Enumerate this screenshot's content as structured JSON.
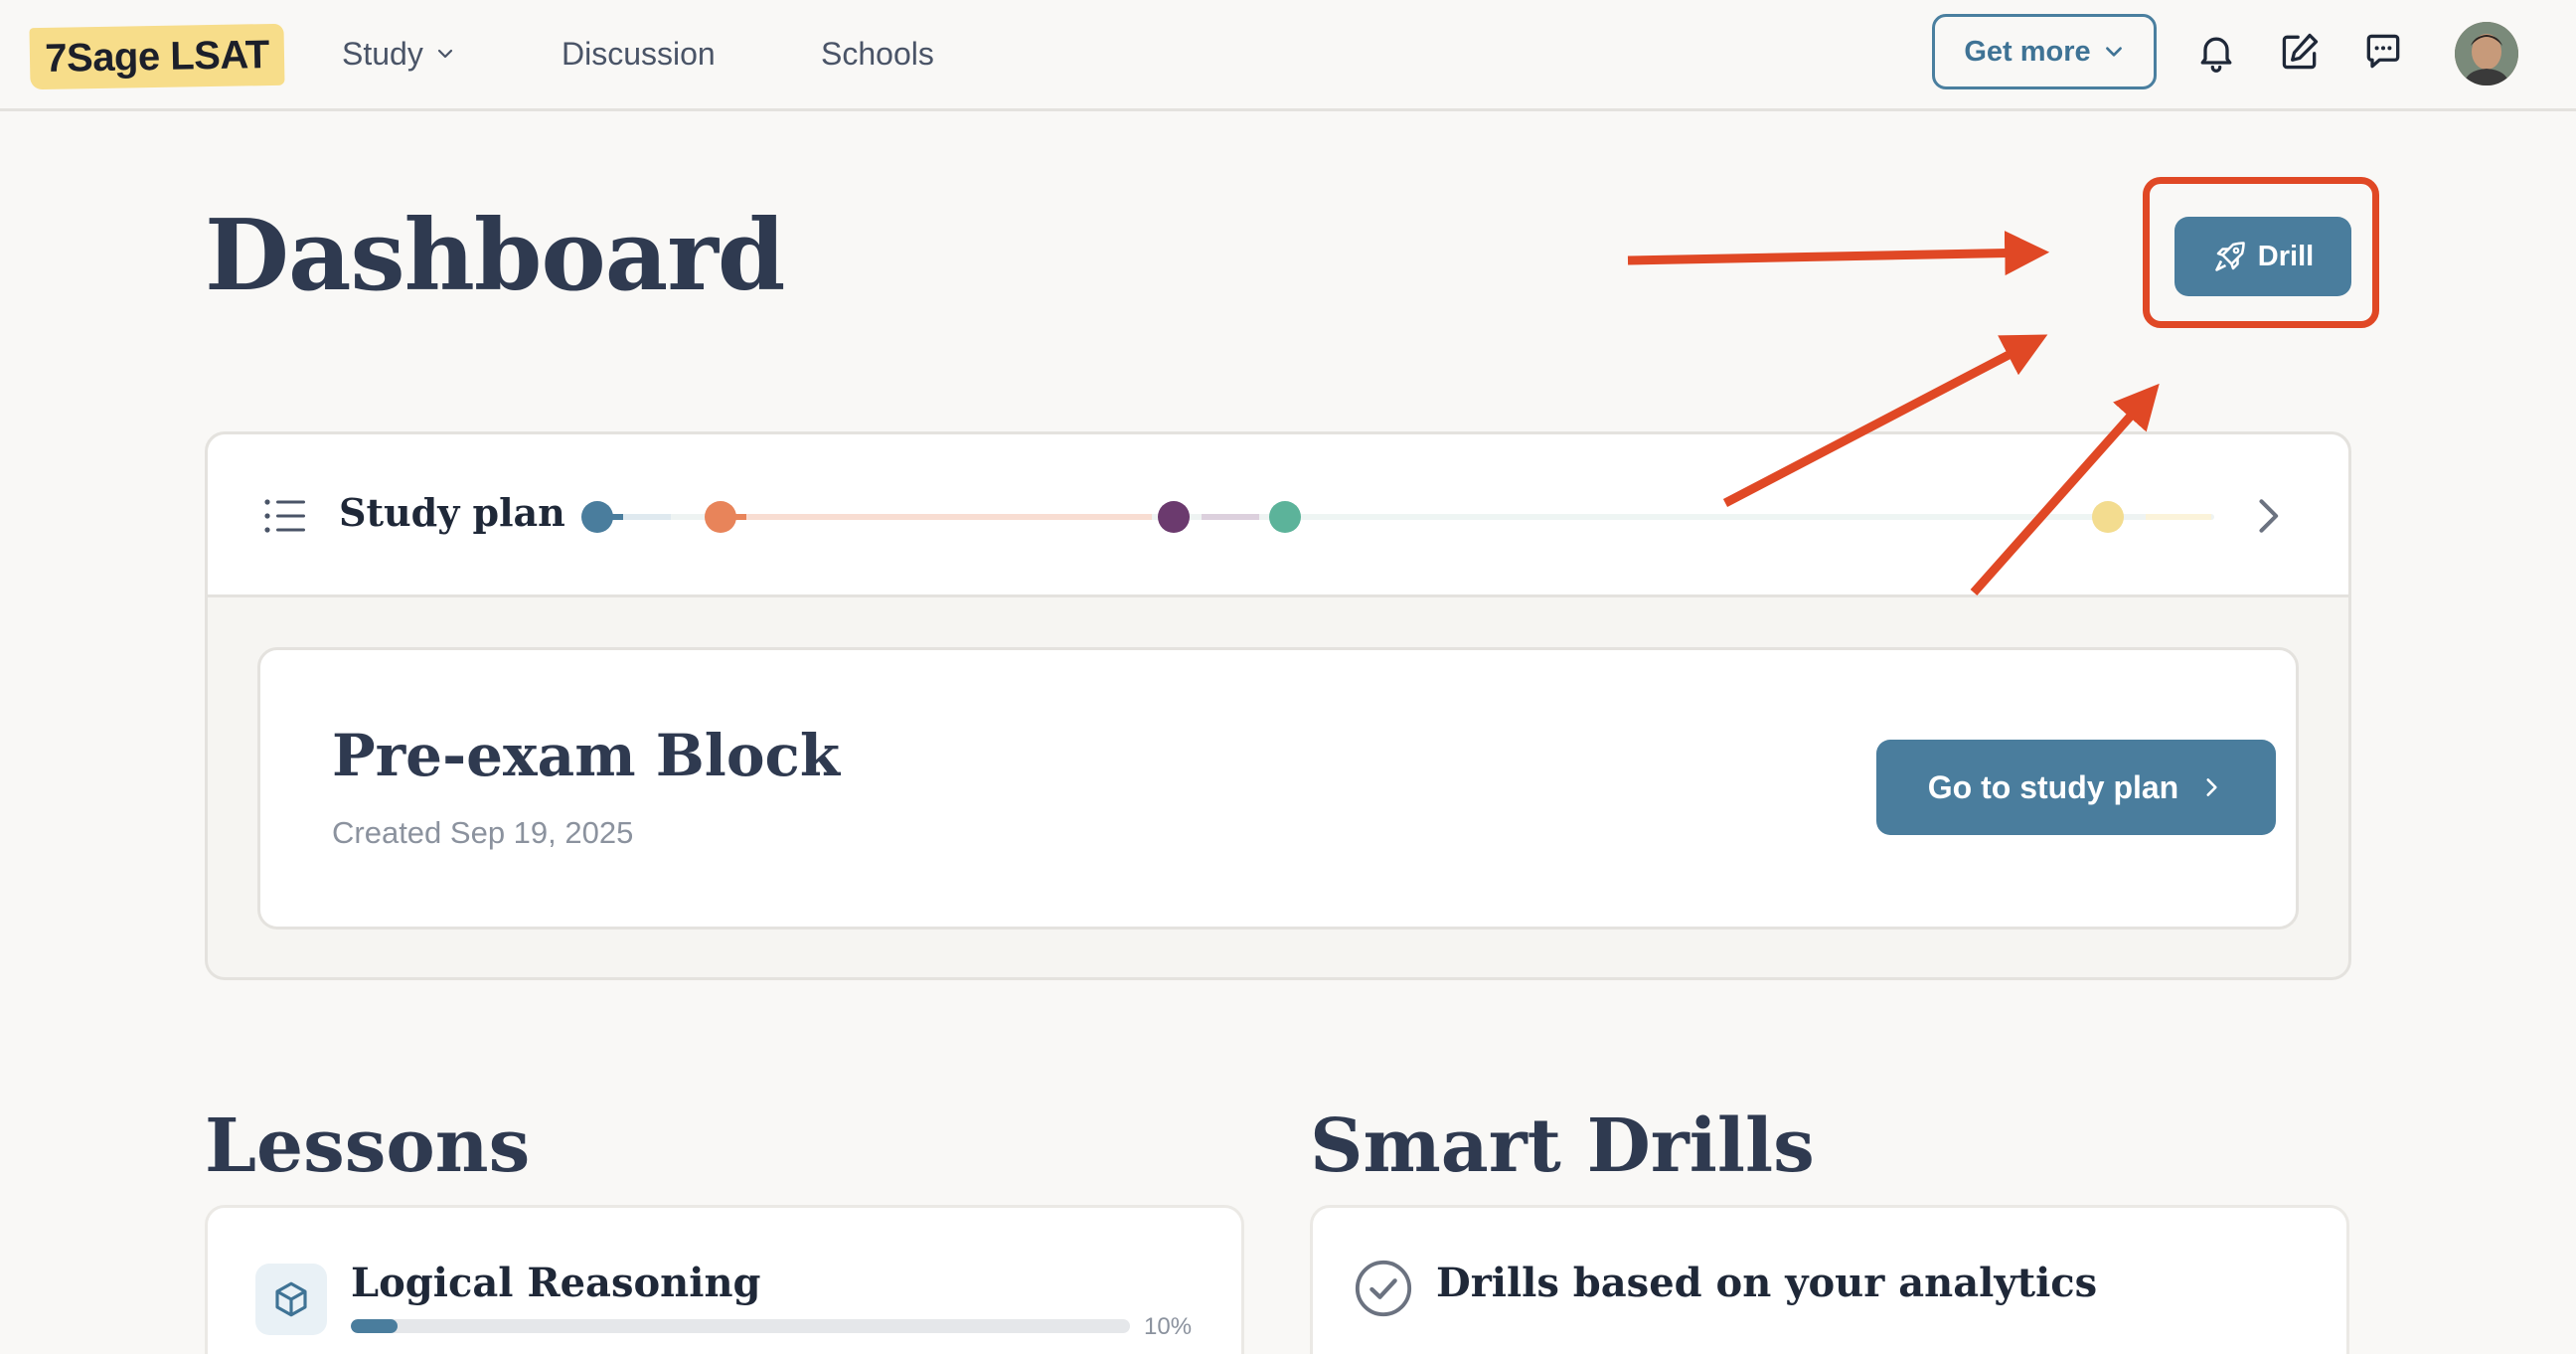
{
  "nav": {
    "logo": "7Sage LSAT",
    "links": [
      {
        "label": "Study",
        "has_dropdown": true
      },
      {
        "label": "Discussion"
      },
      {
        "label": "Schools"
      }
    ],
    "get_more": "Get more",
    "icons": [
      "bell-icon",
      "edit-icon",
      "chat-icon",
      "avatar"
    ]
  },
  "header": {
    "title": "Dashboard",
    "drill_button": "Drill"
  },
  "study_plan": {
    "title": "Study plan",
    "timeline_colors": [
      "#4a7d9d",
      "#e8845a",
      "#6b3a6e",
      "#5cb39a",
      "#f3dc8f"
    ],
    "block": {
      "title": "Pre-exam Block",
      "created": "Created Sep 19, 2025",
      "button": "Go to study plan"
    }
  },
  "lessons": {
    "title": "Lessons",
    "items": [
      {
        "label": "Logical Reasoning",
        "progress": 10,
        "progress_label": "10%"
      }
    ]
  },
  "smart_drills": {
    "title": "Smart Drills",
    "item": "Drills based on your analytics"
  },
  "colors": {
    "accent": "#4a7d9d",
    "annotation": "#e04825",
    "logo_highlight": "#f7dd8a"
  }
}
